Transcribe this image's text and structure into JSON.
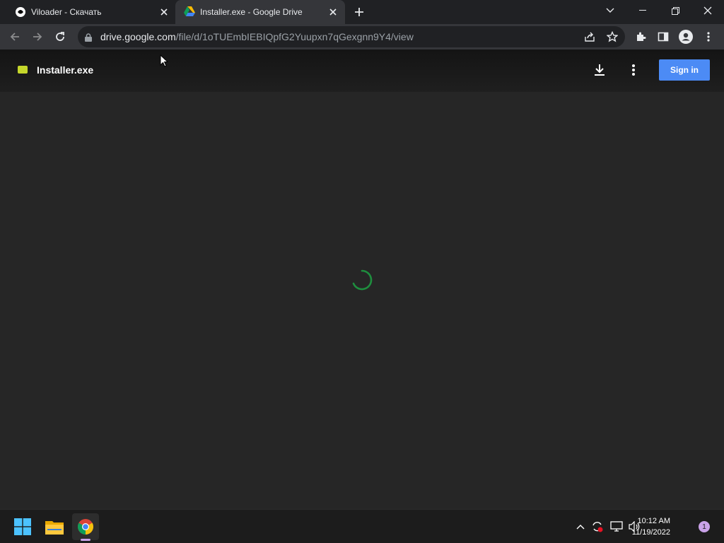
{
  "browser": {
    "tabs": [
      {
        "title": "Viloader - Скачать",
        "active": false
      },
      {
        "title": "Installer.exe - Google Drive",
        "active": true
      }
    ],
    "address": {
      "host": "drive.google.com",
      "path": "/file/d/1oTUEmbIEBIQpfG2Yuupxn7qGexgnn9Y4/view"
    }
  },
  "drive": {
    "file_name": "Installer.exe",
    "signin_label": "Sign in",
    "file_icon_color": "#c5d72b",
    "accent": "#4c8bf5",
    "spinner_color": "#1e8e3e"
  },
  "taskbar": {
    "time": "10:12 AM",
    "date": "11/19/2022",
    "notification_count": "1"
  }
}
